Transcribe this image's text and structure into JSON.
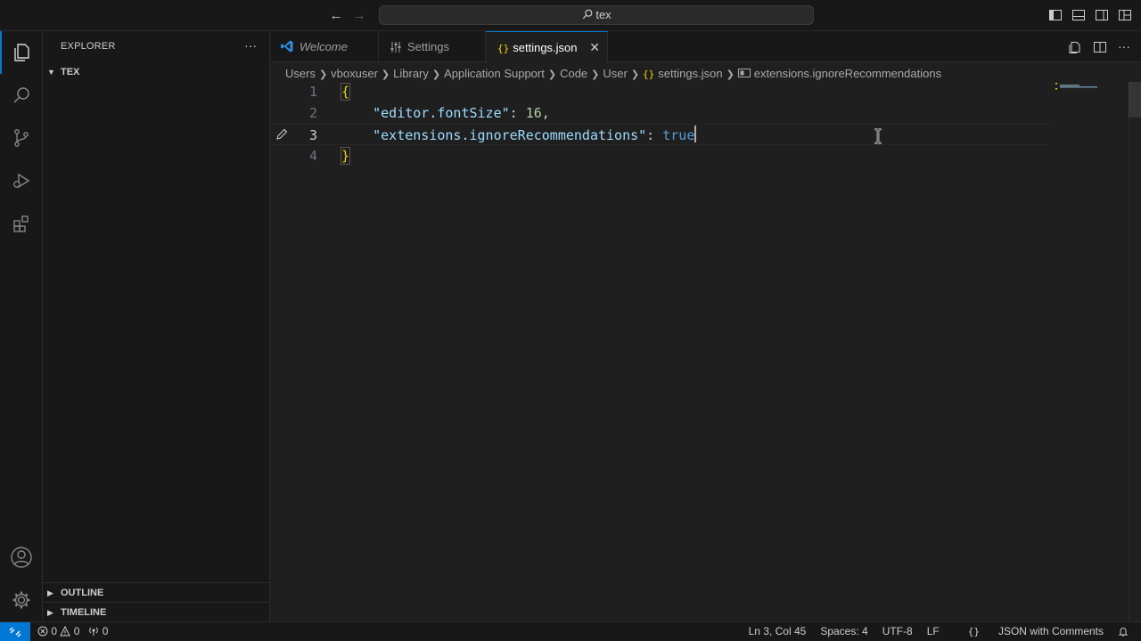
{
  "titlebar": {
    "search_text": "tex",
    "back_label": "←",
    "forward_label": "→"
  },
  "sidebar": {
    "title": "EXPLORER",
    "more_label": "···",
    "folder_name": "TEX",
    "outline_label": "OUTLINE",
    "timeline_label": "TIMELINE"
  },
  "tabs": [
    {
      "label": "Welcome",
      "icon": "vscode-logo-icon",
      "italic": true
    },
    {
      "label": "Settings",
      "icon": "settings-sliders-icon"
    },
    {
      "label": "settings.json",
      "icon": "json-braces-icon",
      "active": true
    }
  ],
  "breadcrumbs": {
    "items": [
      "Users",
      "vboxuser",
      "Library",
      "Application Support",
      "Code",
      "User"
    ],
    "file": "settings.json",
    "symbol": "extensions.ignoreRecommendations"
  },
  "editor": {
    "lines": [
      {
        "num": "1",
        "open": "{"
      },
      {
        "num": "2",
        "key": "\"editor.fontSize\"",
        "colon": ": ",
        "value": "16",
        "tail": ","
      },
      {
        "num": "3",
        "key": "\"extensions.ignoreRecommendations\"",
        "colon": ": ",
        "value": "true"
      },
      {
        "num": "4",
        "close": "}"
      }
    ]
  },
  "statusbar": {
    "errors": "0",
    "warnings": "0",
    "ports": "0",
    "position": "Ln 3, Col 45",
    "spaces": "Spaces: 4",
    "encoding": "UTF-8",
    "eol": "LF",
    "language": "JSON with Comments"
  },
  "colors": {
    "accent": "#0078d4",
    "brace": "#f1d700",
    "key": "#9cdcfe",
    "number": "#b5cea8",
    "boolean": "#569cd6"
  }
}
